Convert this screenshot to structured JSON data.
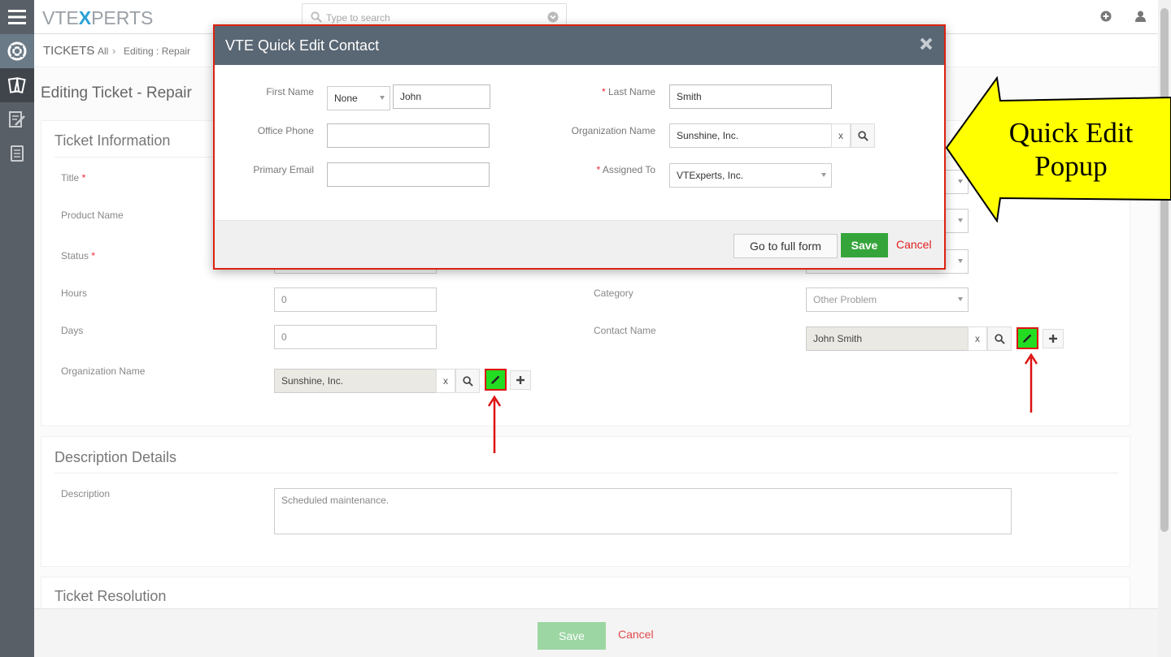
{
  "header": {
    "logo_pre": "VTE",
    "logo_x": "X",
    "logo_post": "PERTS",
    "search_placeholder": "Type to search"
  },
  "breadcrumb": {
    "module": "TICKETS",
    "filter": "All",
    "record": "Editing : Repair"
  },
  "page": {
    "title": "Editing Ticket - Repair"
  },
  "ticket_info": {
    "section_title": "Ticket Information",
    "title_label": "Title",
    "product_label": "Product Name",
    "status_label": "Status",
    "hours_label": "Hours",
    "hours_value": "0",
    "days_label": "Days",
    "days_value": "0",
    "org_label": "Organization Name",
    "org_value": "Sunshine, Inc.",
    "category_label": "Category",
    "category_value": "Other Problem",
    "contact_label": "Contact Name",
    "contact_value": "John Smith",
    "clear_x": "x",
    "required_mark": "*"
  },
  "description": {
    "section_title": "Description Details",
    "label": "Description",
    "value": "Scheduled maintenance."
  },
  "resolution": {
    "section_title": "Ticket Resolution"
  },
  "footer": {
    "save_label": "Save",
    "cancel_label": "Cancel"
  },
  "modal": {
    "title": "VTE Quick Edit Contact",
    "first_name_label": "First Name",
    "salutation_value": "None",
    "first_name_value": "John",
    "last_name_label": "Last Name",
    "last_name_value": "Smith",
    "office_phone_label": "Office Phone",
    "office_phone_value": "",
    "org_label": "Organization Name",
    "org_value": "Sunshine, Inc.",
    "org_clear": "x",
    "email_label": "Primary Email",
    "email_value": "",
    "assigned_label": "Assigned To",
    "assigned_value": "VTExperts, Inc.",
    "required_mark": "*",
    "full_form_label": "Go to full form",
    "save_label": "Save",
    "cancel_label": "Cancel"
  },
  "annotation": {
    "callout_line1": "Quick Edit",
    "callout_line2": "Popup"
  },
  "colors": {
    "rail": "#595f66",
    "modal_header": "#596673",
    "modal_border": "#dd2222",
    "save_green": "#35a53b",
    "quick_edit_btn": "#22dd22",
    "callout_fill": "#ffff00",
    "arrow_red": "#dd1111"
  }
}
